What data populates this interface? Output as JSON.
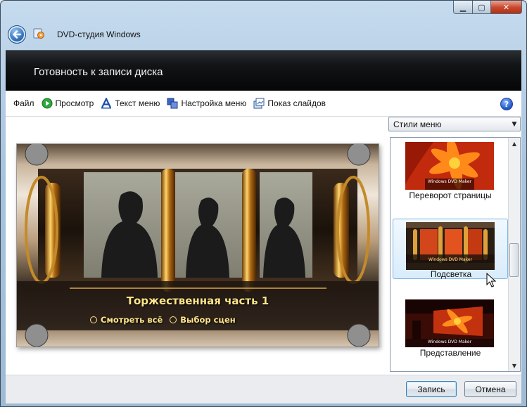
{
  "window": {
    "title": "DVD-студия Windows",
    "controls": {
      "minimize": "▁",
      "maximize": "▢",
      "close": "✕"
    }
  },
  "header": {
    "title": "Готовность к записи диска"
  },
  "toolbar": {
    "items": [
      {
        "label": "Файл",
        "icon": "none"
      },
      {
        "label": "Просмотр",
        "icon": "play-icon"
      },
      {
        "label": "Текст меню",
        "icon": "text-a-icon"
      },
      {
        "label": "Настройка меню",
        "icon": "customize-icon"
      },
      {
        "label": "Показ слайдов",
        "icon": "slideshow-icon"
      }
    ],
    "help": "?"
  },
  "preview": {
    "menu_title": "Торжественная часть 1",
    "links": [
      "Смотреть всё",
      "Выбор сцен"
    ]
  },
  "styles": {
    "dropdown_value": "Стили меню",
    "items": [
      {
        "label": "Переворот страницы",
        "selected": false
      },
      {
        "label": "Подсветка",
        "selected": true
      },
      {
        "label": "Представление",
        "selected": false
      }
    ],
    "thumb_caption": "Windows DVD Maker"
  },
  "footer": {
    "burn_label": "Запись",
    "cancel_label": "Отмена"
  }
}
